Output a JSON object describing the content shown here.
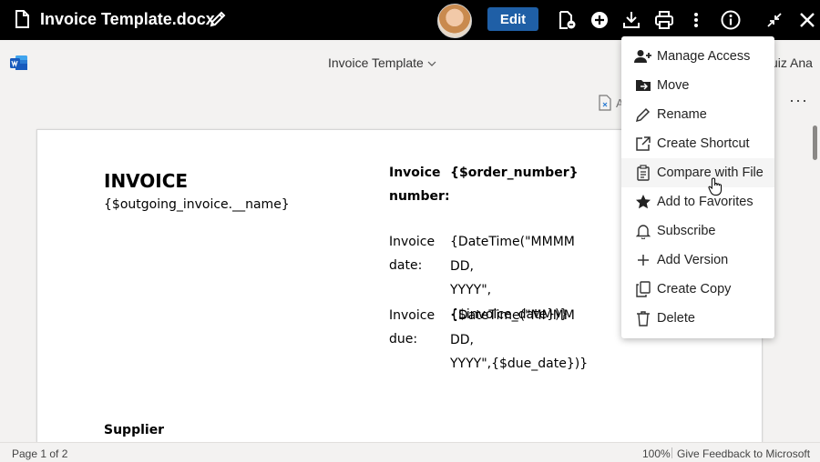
{
  "topbar": {
    "title": "Invoice Template.docx",
    "edit_label": "Edit",
    "icons": [
      "document-icon",
      "pencil-icon",
      "avatar",
      "edit-button",
      "file-info-icon",
      "add-circle-icon",
      "download-icon",
      "print-icon",
      "more-vertical-icon",
      "info-icon",
      "collapse-icon",
      "close-icon"
    ]
  },
  "word": {
    "doc_title": "Invoice Template",
    "user_name": "uiz Ana",
    "ribbon_label": "A",
    "more": "···"
  },
  "document": {
    "heading": "INVOICE",
    "outgoing_name": "{$outgoing_invoice.__name}",
    "invoice_number_label_1": "Invoice",
    "invoice_number_label_2": "number:",
    "invoice_number_value": "{$order_number}",
    "invoice_date_label_1": "Invoice",
    "invoice_date_label_2": "date:",
    "invoice_date_value_1": "{DateTime(\"MMMM",
    "invoice_date_value_2": "DD,",
    "invoice_date_value_3": "YYYY\",{$invoice_date})}",
    "invoice_due_label_1": "Invoice",
    "invoice_due_label_2": "due:",
    "invoice_due_value_1": "{DateTime(\"MMMM",
    "invoice_due_value_2": "DD,",
    "invoice_due_value_3": "YYYY\",{$due_date})}",
    "supplier": "Supplier"
  },
  "status": {
    "page_count": "Page 1 of 2",
    "zoom": "100%",
    "feedback": "Give Feedback to Microsoft"
  },
  "menu": {
    "items": [
      {
        "label": "Manage Access",
        "icon": "user-plus-icon"
      },
      {
        "label": "Move",
        "icon": "folder-move-icon"
      },
      {
        "label": "Rename",
        "icon": "pencil-icon"
      },
      {
        "label": "Create Shortcut",
        "icon": "external-link-icon"
      },
      {
        "label": "Compare with File",
        "icon": "clipboard-icon"
      },
      {
        "label": "Add to Favorites",
        "icon": "star-icon"
      },
      {
        "label": "Subscribe",
        "icon": "bell-icon"
      },
      {
        "label": "Add Version",
        "icon": "plus-icon"
      },
      {
        "label": "Create Copy",
        "icon": "copy-icon"
      },
      {
        "label": "Delete",
        "icon": "trash-icon"
      }
    ]
  },
  "colors": {
    "topbar_bg": "#000000",
    "edit_button": "#1f5fa6",
    "word_blue": "#185abd"
  }
}
